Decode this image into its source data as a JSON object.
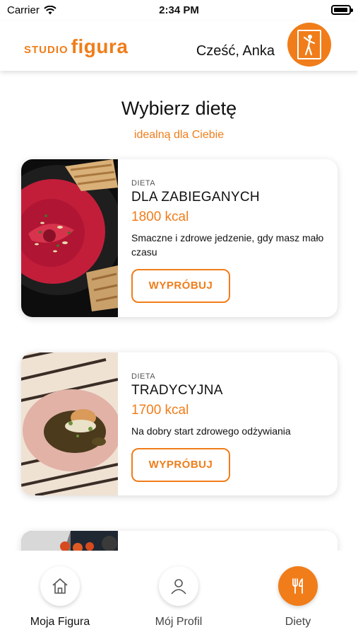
{
  "status": {
    "carrier": "Carrier",
    "time": "2:34 PM",
    "battery_level": 0.95
  },
  "header": {
    "logo_small": "STUDIO",
    "logo_big": "figura",
    "greeting": "Cześć, Anka"
  },
  "page": {
    "title": "Wybierz dietę",
    "subtitle": "idealną dla Ciebie"
  },
  "diets": [
    {
      "kicker": "DIETA",
      "name": "DLA ZABIEGANYCH",
      "kcal": "1800 kcal",
      "description": "Smaczne i zdrowe jedzenie, gdy masz mało czasu",
      "button": "WYPRÓBUJ"
    },
    {
      "kicker": "DIETA",
      "name": "TRADYCYJNA",
      "kcal": "1700 kcal",
      "description": "Na dobry start zdrowego odżywiania",
      "button": "WYPRÓBUJ"
    }
  ],
  "tabs": [
    {
      "label": "Moja Figura",
      "icon": "home-icon"
    },
    {
      "label": "Mój Profil",
      "icon": "user-icon"
    },
    {
      "label": "Diety",
      "icon": "fork-knife-icon",
      "active": true
    }
  ],
  "colors": {
    "accent": "#f07d1a",
    "text": "#111111"
  }
}
